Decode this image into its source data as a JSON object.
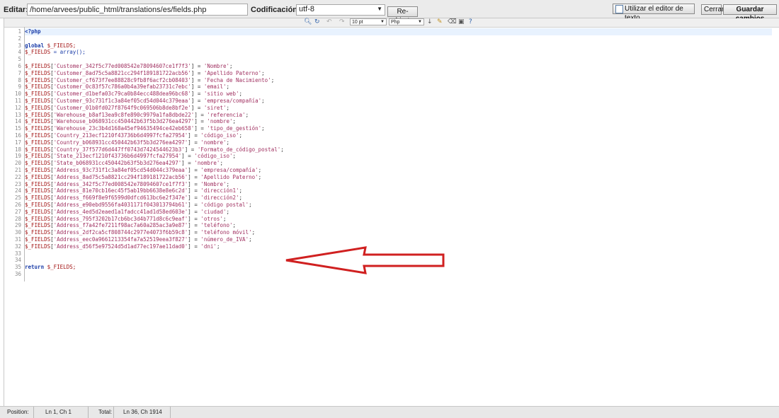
{
  "toolbar": {
    "edit_label": "Editar:",
    "path_value": "/home/arvees/public_html/translations/es/fields.php",
    "encoding_label": "Codificación:",
    "encoding_value": "utf-8",
    "reopen_label": "Re-abierto",
    "text_editor_label": "Utilizar el editor de texto.",
    "cancel_label": "Cerrar",
    "save_label": "Guardar cambios"
  },
  "editor_toolbar": {
    "font_size": "10 pt",
    "language": "Php",
    "icons": [
      "search-icon",
      "refresh-icon",
      "undo-icon",
      "redo-icon",
      "go-line-icon",
      "highlight-icon",
      "reset-icon",
      "fullscreen-icon",
      "help-icon"
    ]
  },
  "code": {
    "line_numbers": [
      "1",
      "2",
      "3",
      "4",
      "5",
      "6",
      "7",
      "8",
      "9",
      "10",
      "11",
      "12",
      "13",
      "14",
      "15",
      "16",
      "17",
      "18",
      "19",
      "20",
      "21",
      "22",
      "23",
      "24",
      "25",
      "26",
      "27",
      "28",
      "29",
      "30",
      "31",
      "32",
      "33",
      "34",
      "35",
      "36"
    ],
    "lines": [
      {
        "type": "php_open",
        "text": "<?php"
      },
      {
        "type": "blank"
      },
      {
        "type": "global",
        "kw": "global",
        "var": "$_FIELDS;"
      },
      {
        "type": "array",
        "var": "$_FIELDS",
        "rest": " = array();"
      },
      {
        "type": "blank"
      },
      {
        "type": "field",
        "key": "'Customer_342f5c77ed008542e78094607ce1f7f3'",
        "val": "'Nombre'"
      },
      {
        "type": "field",
        "key": "'Customer_8ad75c5a8821cc294f189181722acb56'",
        "val": "'Apellido Paterno'"
      },
      {
        "type": "field",
        "key": "'Customer_cf673f7ee88828c9fb8f6acf2cb08403'",
        "val": "'Fecha de Nacimiento'"
      },
      {
        "type": "field",
        "key": "'Customer_0c83f57c786a0b4a39efab23731c7ebc'",
        "val": "'email'"
      },
      {
        "type": "field",
        "key": "'Customer_d1befa03c79ca0b84ecc488dea96bc68'",
        "val": "'sitio web'"
      },
      {
        "type": "field",
        "key": "'Customer_93c731f1c3a84ef05cd54d044c379eaa'",
        "val": "'empresa/compañía'"
      },
      {
        "type": "field",
        "key": "'Customer_01b0fd027f8764f9c069506b8de8bf2e'",
        "val": "'siret'"
      },
      {
        "type": "field",
        "key": "'Warehouse_b8af13ea9c8fe890c9979a1fa8dbde22'",
        "val": "'referencia'"
      },
      {
        "type": "field",
        "key": "'Warehouse_b068931cc450442b63f5b3d276ea4297'",
        "val": "'nombre'"
      },
      {
        "type": "field",
        "key": "'Warehouse_23c3b4d168a45ef94635494ce42eb658'",
        "val": "'tipo_de_gestión'"
      },
      {
        "type": "field",
        "key": "'Country_213ecf1210f43736b6d4997fcfa27954'",
        "val": "'código_iso'"
      },
      {
        "type": "field",
        "key": "'Country_b068931cc450442b63f5b3d276ea4297'",
        "val": "'nombre'"
      },
      {
        "type": "field",
        "key": "'Country_37f577d6d447ff0743d7424544623b3'",
        "val": "'Formato_de_código_postal'"
      },
      {
        "type": "field",
        "key": "'State_213ecf1210f43736b6d4997fcfa27954'",
        "val": "'código_iso'"
      },
      {
        "type": "field",
        "key": "'State_b068931cc450442b63f5b3d276ea4297'",
        "val": "'nombre'"
      },
      {
        "type": "field",
        "key": "'Address_93c731f1c3a84ef05cd54d044c379eaa'",
        "val": "'empresa/compañía'"
      },
      {
        "type": "field",
        "key": "'Address_8ad75c5a8821cc294f189181722acb56'",
        "val": "'Apellido Paterno'"
      },
      {
        "type": "field",
        "key": "'Address_342f5c77ed008542e78094607ce1f7f3'",
        "val": "'Nombre'"
      },
      {
        "type": "field",
        "key": "'Address_81e70cb16ec45f5ab19bb6638e8e6c2d'",
        "val": "'dirección1'"
      },
      {
        "type": "field",
        "key": "'Address_f669f8e9f6599d0dfcd613bc6e2f347e'",
        "val": "'dirección2'"
      },
      {
        "type": "field",
        "key": "'Address_e90ebd9556fa4031171f043013794b61'",
        "val": "'código postal'"
      },
      {
        "type": "field",
        "key": "'Address_4ed5d2eaed1a1fadcc41ad1d58ed603e'",
        "val": "'ciudad'"
      },
      {
        "type": "field",
        "key": "'Address_795f3202b17cb6bc3d4b771d8c6c9eaf'",
        "val": "'otros'"
      },
      {
        "type": "field",
        "key": "'Address_f7a42fe7211f98ac7a60a285ac3a9e87'",
        "val": "'teléfono'"
      },
      {
        "type": "field",
        "key": "'Address_2df2ca5cf808744c2977e4073f6b59c8'",
        "val": "'teléfono móvil'"
      },
      {
        "type": "field",
        "key": "'Address_eec0a9661213354fa7a52519eea3f827'",
        "val": "'número_de_IVA'"
      },
      {
        "type": "field",
        "key": "'Address_d56f5e97524d5d1ad77ec197ae11dad0'",
        "val": "'dni'"
      },
      {
        "type": "blank"
      },
      {
        "type": "blank"
      },
      {
        "type": "return",
        "kw": "return",
        "var": "$_FIELDS;"
      },
      {
        "type": "blank"
      }
    ],
    "field_var": "$_FIELDS",
    "assign": " = ",
    "line_end": ";"
  },
  "colors": {
    "arrow": "#d02020",
    "variable": "#a31515",
    "keyword": "#1a3ca8",
    "string": "#a03060"
  },
  "statusbar": {
    "position_label": "Position:",
    "position_value": "Ln 1, Ch 1",
    "total_label": "Total:",
    "total_value": "Ln 36, Ch 1914"
  }
}
